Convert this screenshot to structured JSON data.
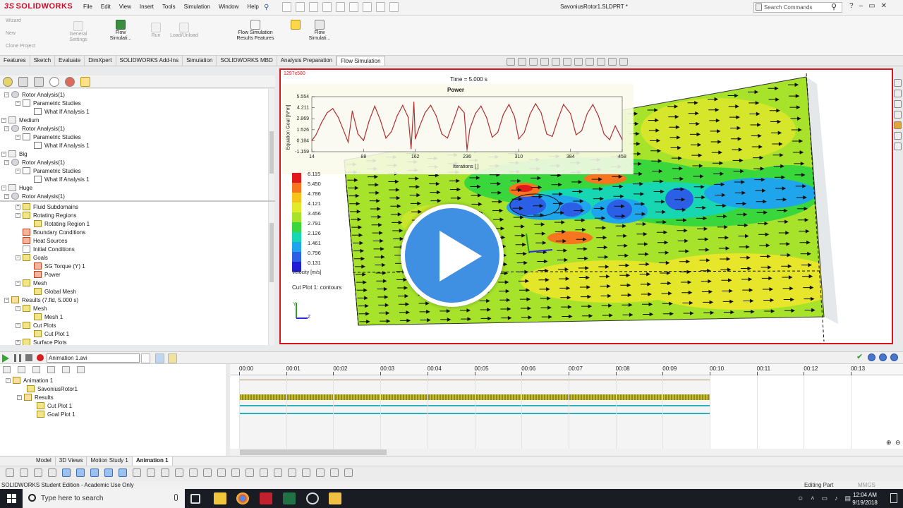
{
  "app": {
    "brand": "SOLIDWORKS",
    "document_title": "SavoniusRotor1.SLDPRT *",
    "menu": [
      "File",
      "Edit",
      "View",
      "Insert",
      "Tools",
      "Simulation",
      "Window",
      "Help"
    ],
    "search_placeholder": "Search Commands",
    "window_controls": [
      "?",
      "–",
      "▭",
      "✕"
    ]
  },
  "ribbon": {
    "buttons": [
      {
        "label": "Wizard"
      },
      {
        "label": "New"
      },
      {
        "label": "Clone Project"
      },
      {
        "label": "General Settings"
      },
      {
        "label": "Flow Simulati..."
      },
      {
        "label": "Run"
      },
      {
        "label": "Load/Unload"
      },
      {
        "label": "Flow Simulation Results Features"
      },
      {
        "label": "Flow Simulati..."
      }
    ]
  },
  "command_tabs": [
    "Features",
    "Sketch",
    "Evaluate",
    "DimXpert",
    "SOLIDWORKS Add-Ins",
    "Simulation",
    "SOLIDWORKS MBD",
    "Analysis Preparation",
    "Flow Simulation"
  ],
  "active_command_tab": "Flow Simulation",
  "tree_top": [
    {
      "label": "Rotor Analysis(1)"
    },
    {
      "label": "Parametric Studies"
    },
    {
      "label": "What If Analysis 1"
    },
    {
      "label": "Medium"
    },
    {
      "label": "Rotor Analysis(1)"
    },
    {
      "label": "Parametric Studies"
    },
    {
      "label": "What If Analysis 1"
    },
    {
      "label": "Big"
    },
    {
      "label": "Rotor Analysis(1)"
    },
    {
      "label": "Parametric Studies"
    },
    {
      "label": "What If Analysis 1"
    },
    {
      "label": "Huge"
    },
    {
      "label": "Rotor Analysis(1)"
    }
  ],
  "tree_bottom": [
    {
      "label": "Fluid Subdomains"
    },
    {
      "label": "Rotating Regions"
    },
    {
      "label": "Rotating Region 1"
    },
    {
      "label": "Boundary Conditions"
    },
    {
      "label": "Heat Sources"
    },
    {
      "label": "Initial Conditions"
    },
    {
      "label": "Goals"
    },
    {
      "label": "SG Torque (Y) 1"
    },
    {
      "label": "Power"
    },
    {
      "label": "Mesh"
    },
    {
      "label": "Global Mesh"
    },
    {
      "label": "Results (7.fld, 5.000 s)"
    },
    {
      "label": "Mesh"
    },
    {
      "label": "Mesh 1"
    },
    {
      "label": "Cut Plots"
    },
    {
      "label": "Cut Plot 1"
    },
    {
      "label": "Surface Plots"
    }
  ],
  "viewport": {
    "resolution": "1297x580",
    "time_label": "Time = 5.000 s",
    "cut_plot_label": "Cut Plot 1: contours",
    "legend_title": "Velocity [m/s]",
    "legend_values": [
      "6.115",
      "5.450",
      "4.786",
      "4.121",
      "3.456",
      "2.791",
      "2.126",
      "1.461",
      "0.796",
      "0.131"
    ],
    "legend_colors": [
      "#e01a1a",
      "#f7751e",
      "#f7c21a",
      "#e2ea2a",
      "#a6e32a",
      "#39d63c",
      "#17d7b2",
      "#1fa5ec",
      "#2a5fe6",
      "#1e1fd4"
    ],
    "axis_z_label": "Z",
    "axis_y_label": "Y"
  },
  "goal_plot": {
    "title": "Power",
    "ylabel": "Equation Goal [N*m]",
    "xlabel": "Iterations [ ]",
    "y_ticks": [
      "5.554",
      "4.211",
      "2.869",
      "1.526",
      "0.184",
      "-1.159"
    ],
    "x_ticks": [
      "14",
      "88",
      "162",
      "236",
      "310",
      "384",
      "458"
    ]
  },
  "chart_data": {
    "type": "line",
    "title": "Power",
    "xlabel": "Iterations [ ]",
    "ylabel": "Equation Goal [N*m]",
    "xlim": [
      14,
      458
    ],
    "ylim": [
      -1.159,
      5.554
    ],
    "series": [
      {
        "color": "#b03030",
        "x": [
          14,
          20,
          28,
          36,
          44,
          52,
          60,
          66,
          72,
          80,
          88,
          96,
          104,
          112,
          120,
          128,
          136,
          144,
          152,
          156,
          160,
          162,
          168,
          176,
          184,
          192,
          200,
          208,
          216,
          224,
          232,
          236,
          240,
          248,
          256,
          264,
          272,
          280,
          288,
          296,
          304,
          310,
          318,
          326,
          334,
          342,
          350,
          358,
          366,
          374,
          384,
          392,
          400,
          408,
          416,
          424,
          432,
          440,
          448,
          458
        ],
        "y": [
          0.2,
          0.9,
          2.4,
          3.6,
          4.1,
          3.0,
          1.3,
          0.0,
          3.8,
          1.0,
          0.2,
          2.6,
          4.4,
          2.7,
          0.5,
          1.3,
          3.2,
          4.5,
          3.0,
          -0.8,
          4.9,
          0.4,
          1.9,
          3.6,
          4.5,
          3.2,
          1.0,
          0.5,
          2.4,
          4.4,
          3.6,
          -0.9,
          1.6,
          3.5,
          4.4,
          3.0,
          0.6,
          1.2,
          3.4,
          4.6,
          3.1,
          0.4,
          1.2,
          3.4,
          4.7,
          3.6,
          1.0,
          0.7,
          2.8,
          4.6,
          3.5,
          0.9,
          1.4,
          3.5,
          4.6,
          3.2,
          1.0,
          0.3,
          2.0,
          0.3
        ]
      }
    ]
  },
  "animation": {
    "file": "Animation 1.avi",
    "tree": [
      {
        "label": "Animation 1"
      },
      {
        "label": "SavoniusRotor1"
      },
      {
        "label": "Results"
      },
      {
        "label": "Cut Plot 1"
      },
      {
        "label": "Goal Plot 1"
      }
    ],
    "timeline_ticks": [
      "00:00",
      "00:01",
      "00:02",
      "00:03",
      "00:04",
      "00:05",
      "00:06",
      "00:07",
      "00:08",
      "00:09",
      "00:10",
      "00:11",
      "00:12",
      "00:13"
    ]
  },
  "bottom_tabs": [
    "Model",
    "3D Views",
    "Motion Study 1",
    "Animation 1"
  ],
  "active_bottom_tab": "Animation 1",
  "status": {
    "left": "SOLIDWORKS Student Edition - Academic Use Only",
    "mode": "Editing Part",
    "units": "MMGS"
  },
  "taskbar": {
    "search_placeholder": "Type here to search",
    "time": "12:04 AM",
    "date": "9/19/2018"
  }
}
